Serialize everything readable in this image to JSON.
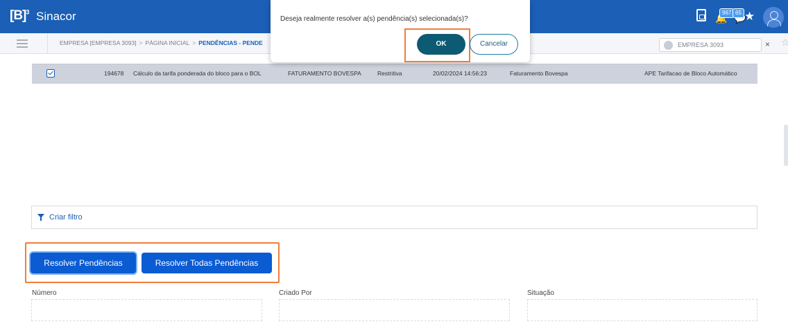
{
  "app": {
    "logo": "[B]",
    "logo_sup": "3",
    "title": "Sinacor",
    "badges": {
      "notifications": "967",
      "messages": "65"
    }
  },
  "subbar": {
    "breadcrumb": [
      "EMPRESA [EMPRESA 3093]",
      "PÁGINA INICIAL",
      "PENDÊNCIAS - PENDE"
    ],
    "company": "EMPRESA 3093"
  },
  "grid": {
    "rows": [
      {
        "numero": "194678",
        "descricao": "Cálculo da tarifa ponderada do bloco para o BOL",
        "sistema": "FATURAMENTO BOVESPA",
        "tipo": "Restritiva",
        "data": "20/02/2024 14:56:23",
        "modulo": "Faturamento Bovespa",
        "rotina": "APE Tarifacao de Bloco Automático"
      }
    ]
  },
  "filter": {
    "label": "Criar filtro"
  },
  "actions": {
    "resolver": "Resolver Pendências",
    "resolver_todas": "Resolver Todas Pendências"
  },
  "form": {
    "numero_label": "Número",
    "criado_por_label": "Criado Por",
    "situacao_label": "Situação"
  },
  "modal": {
    "message": "Deseja realmente resolver a(s) pendência(s) selecionada(s)?",
    "ok": "OK",
    "cancel": "Cancelar"
  },
  "colors": {
    "brand": "#1b5fb6",
    "button": "#0b5bd3",
    "highlight": "#f07d3a",
    "ok": "#0d5a73"
  }
}
